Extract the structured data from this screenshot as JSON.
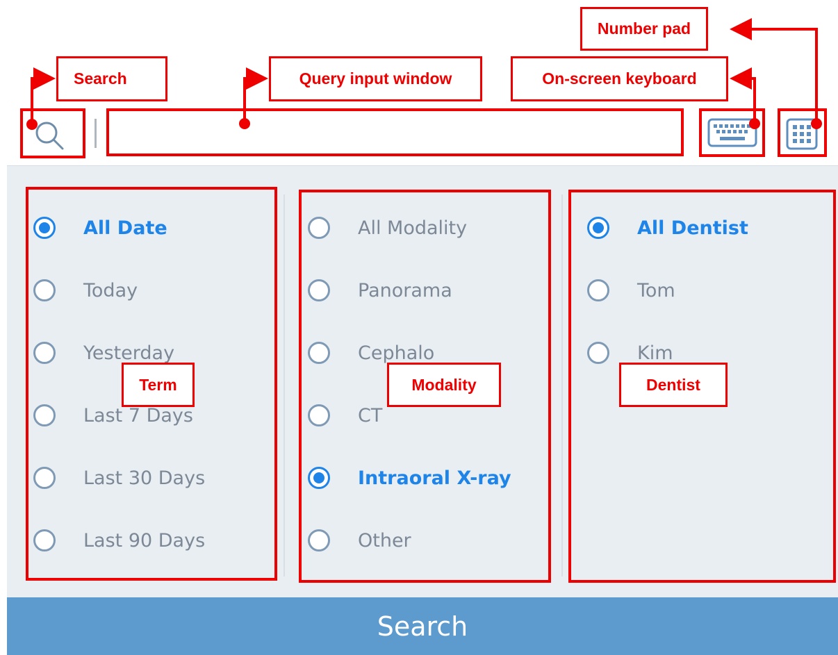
{
  "query": {
    "value": "",
    "placeholder": ""
  },
  "term": {
    "options": [
      {
        "label": "All Date",
        "selected": true
      },
      {
        "label": "Today",
        "selected": false
      },
      {
        "label": "Yesterday",
        "selected": false
      },
      {
        "label": "Last 7 Days",
        "selected": false
      },
      {
        "label": "Last 30 Days",
        "selected": false
      },
      {
        "label": "Last 90 Days",
        "selected": false
      }
    ]
  },
  "modality": {
    "options": [
      {
        "label": "All Modality",
        "selected": false
      },
      {
        "label": "Panorama",
        "selected": false
      },
      {
        "label": "Cephalo",
        "selected": false
      },
      {
        "label": "CT",
        "selected": false
      },
      {
        "label": "Intraoral X-ray",
        "selected": true
      },
      {
        "label": "Other",
        "selected": false
      }
    ]
  },
  "dentist": {
    "options": [
      {
        "label": "All Dentist",
        "selected": true
      },
      {
        "label": "Tom",
        "selected": false
      },
      {
        "label": "Kim",
        "selected": false
      }
    ]
  },
  "search_button": {
    "label": "Search"
  },
  "annotations": {
    "number_pad": "Number pad",
    "search": "Search",
    "query_input_window": "Query input window",
    "onscreen_keyboard": "On-screen keyboard",
    "term": "Term",
    "modality": "Modality",
    "dentist": "Dentist"
  },
  "colors": {
    "accent": "#1e84e8",
    "annotation_red": "#ee0000",
    "search_button": "#5d9bcf",
    "panel_bg": "#e9eef3"
  },
  "icons": [
    "search-icon",
    "keyboard-icon",
    "number-pad-icon"
  ]
}
